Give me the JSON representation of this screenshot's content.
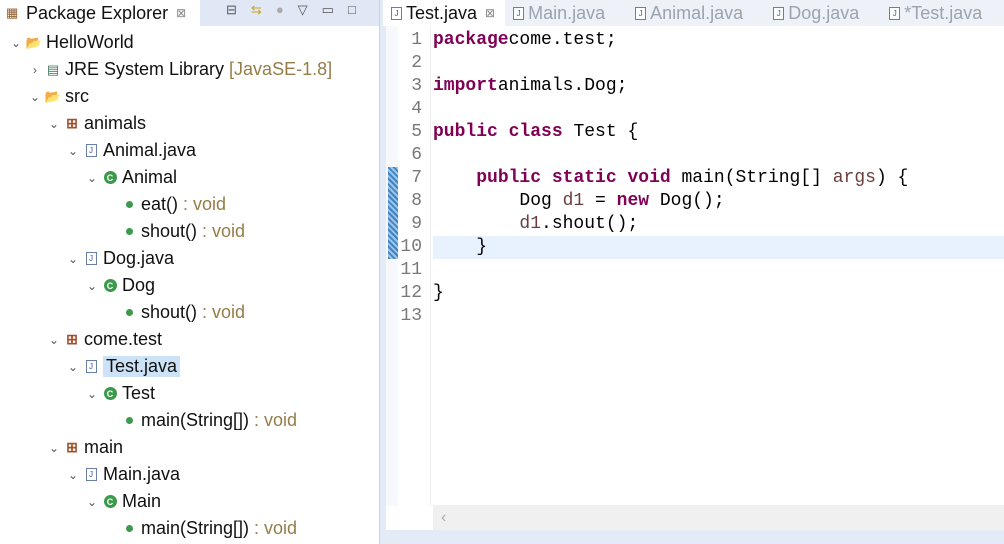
{
  "explorer": {
    "title": "Package Explorer",
    "close": "⊠",
    "tree": [
      {
        "label": "HelloWorld",
        "suffix": "",
        "level": 0,
        "chev": "⌄",
        "icon": "project-icon"
      },
      {
        "label": "JRE System Library",
        "suffix": " [JavaSE-1.8]",
        "level": 1,
        "chev": "›",
        "icon": "library-icon"
      },
      {
        "label": "src",
        "suffix": "",
        "level": 1,
        "chev": "⌄",
        "icon": "source-folder-icon"
      },
      {
        "label": "animals",
        "suffix": "",
        "level": 2,
        "chev": "⌄",
        "icon": "package-icon"
      },
      {
        "label": "Animal.java",
        "suffix": "",
        "level": 3,
        "chev": "⌄",
        "icon": "java-file-icon"
      },
      {
        "label": "Animal",
        "suffix": "",
        "level": 4,
        "chev": "⌄",
        "icon": "class-icon"
      },
      {
        "label": "eat()",
        "suffix": " : void",
        "level": 5,
        "chev": "",
        "icon": "method-icon"
      },
      {
        "label": "shout()",
        "suffix": " : void",
        "level": 5,
        "chev": "",
        "icon": "method-icon"
      },
      {
        "label": "Dog.java",
        "suffix": "",
        "level": 3,
        "chev": "⌄",
        "icon": "java-file-icon"
      },
      {
        "label": "Dog",
        "suffix": "",
        "level": 4,
        "chev": "⌄",
        "icon": "class-icon"
      },
      {
        "label": "shout()",
        "suffix": " : void",
        "level": 5,
        "chev": "",
        "icon": "override-method-icon"
      },
      {
        "label": "come.test",
        "suffix": "",
        "level": 2,
        "chev": "⌄",
        "icon": "package-icon"
      },
      {
        "label": "Test.java",
        "suffix": "",
        "level": 3,
        "chev": "⌄",
        "icon": "java-file-icon",
        "selected": true
      },
      {
        "label": "Test",
        "suffix": "",
        "level": 4,
        "chev": "⌄",
        "icon": "runnable-class-icon"
      },
      {
        "label": "main(String[])",
        "suffix": " : void",
        "level": 5,
        "chev": "",
        "icon": "static-method-icon"
      },
      {
        "label": "main",
        "suffix": "",
        "level": 2,
        "chev": "⌄",
        "icon": "package-icon"
      },
      {
        "label": "Main.java",
        "suffix": "",
        "level": 3,
        "chev": "⌄",
        "icon": "java-file-icon"
      },
      {
        "label": "Main",
        "suffix": "",
        "level": 4,
        "chev": "⌄",
        "icon": "runnable-class-icon"
      },
      {
        "label": "main(String[])",
        "suffix": " : void",
        "level": 5,
        "chev": "",
        "icon": "static-method-icon"
      }
    ]
  },
  "editor": {
    "tabs": [
      {
        "label": "Test.java",
        "active": true
      },
      {
        "label": "Main.java"
      },
      {
        "label": "Animal.java"
      },
      {
        "label": "Dog.java"
      },
      {
        "label": "*Test.java"
      }
    ],
    "lines": [
      [
        [
          "kw",
          "package"
        ],
        [
          "",
          "come.test;"
        ]
      ],
      [],
      [
        [
          "kw",
          "import"
        ],
        [
          "",
          "animals.Dog;"
        ]
      ],
      [],
      [
        [
          "kw",
          "public"
        ],
        [
          "",
          " "
        ],
        [
          "kw",
          "class"
        ],
        [
          "",
          " Test {"
        ]
      ],
      [],
      [
        [
          "",
          "    "
        ],
        [
          "kw",
          "public"
        ],
        [
          "",
          " "
        ],
        [
          "kw",
          "static"
        ],
        [
          "",
          " "
        ],
        [
          "kw",
          "void"
        ],
        [
          "",
          " main(String[] "
        ],
        [
          "var",
          "args"
        ],
        [
          "",
          ") {"
        ]
      ],
      [
        [
          "",
          "        Dog "
        ],
        [
          "var",
          "d1"
        ],
        [
          "",
          " = "
        ],
        [
          "kw",
          "new"
        ],
        [
          "",
          " Dog();"
        ]
      ],
      [
        [
          "",
          "        "
        ],
        [
          "var",
          "d1"
        ],
        [
          "",
          ".shout();"
        ]
      ],
      [
        [
          "",
          "    }"
        ]
      ],
      [],
      [
        [
          "",
          "}"
        ]
      ],
      []
    ],
    "current_line": 10,
    "changed_lines": [
      7,
      8,
      9,
      10
    ],
    "scroll_left": "‹"
  }
}
